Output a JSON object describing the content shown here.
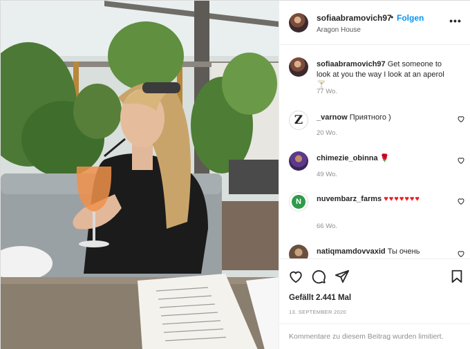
{
  "header": {
    "username": "sofiaabramovich97",
    "separator": "•",
    "follow_label": "Folgen",
    "location": "Aragon House",
    "more_icon": "more-options-icon"
  },
  "caption": {
    "username": "sofiaabramovich97",
    "text": "Get someone to look at you the way I look at an aperol 🍸",
    "time": "77 Wo."
  },
  "comments": [
    {
      "username": "_varnow",
      "text": "Приятного )",
      "time": "20 Wo."
    },
    {
      "username": "chimezie_obinna",
      "text": "🌹",
      "time": "49 Wo."
    },
    {
      "username": "nuvembarz_farms",
      "text": "♥♥♥♥♥♥♥",
      "time": "66 Wo."
    },
    {
      "username": "natiqmamdovvaxid",
      "text": "Ты очень",
      "time": ""
    }
  ],
  "actions": {
    "like_icon": "heart-icon",
    "comment_icon": "comment-icon",
    "share_icon": "share-icon",
    "save_icon": "bookmark-icon",
    "likes_text": "Gefällt 2.441 Mal",
    "date": "13. SEPTEMBER 2020"
  },
  "comments_limited": "Kommentare zu diesem Beitrag wurden limitiert.",
  "colors": {
    "follow_blue": "#0095f6",
    "secondary_text": "#8e8e8e",
    "heart_red": "#ed1c24"
  }
}
